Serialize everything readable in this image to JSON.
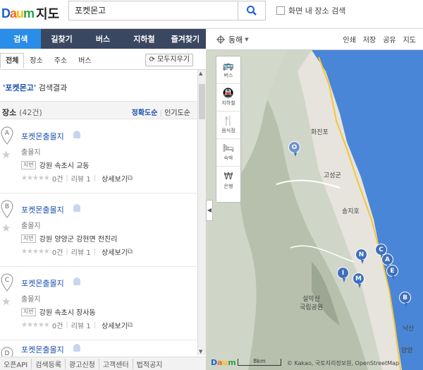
{
  "header": {
    "logo_text": "Daum",
    "map_title": "지도",
    "search_value": "포켓몬고",
    "in_map_label": "화면 내 장소 검색"
  },
  "nav": {
    "tabs": [
      "검색",
      "길찾기",
      "버스",
      "지하철",
      "즐겨찾기"
    ]
  },
  "subtabs": {
    "items": [
      "전체",
      "장소",
      "주소",
      "버스"
    ],
    "clear_label": "모두지우기"
  },
  "results": {
    "keyword": "'포켓몬고'",
    "suffix": " 검색결과",
    "section": "장소",
    "count": "(42건)",
    "sort_accuracy": "정확도순",
    "sort_popularity": "인기도순",
    "items": [
      {
        "letter": "A",
        "name": "포켓몬출몰지",
        "category": "출몰지",
        "jibun": "지번",
        "address": "강원 속초시 교동",
        "reviews_count": "0건",
        "reviews": "리뷰 1",
        "detail": "상세보기"
      },
      {
        "letter": "B",
        "name": "포켓몬출몰지",
        "category": "출몰지",
        "jibun": "지번",
        "address": "강원 양양군 강현면 전진리",
        "reviews_count": "0건",
        "reviews": "리뷰 1",
        "detail": "상세보기"
      },
      {
        "letter": "C",
        "name": "포켓몬출몰지",
        "category": "출몰지",
        "jibun": "지번",
        "address": "강원 속초시 장사동",
        "reviews_count": "0건",
        "reviews": "리뷰 1",
        "detail": "상세보기"
      },
      {
        "letter": "D",
        "name": "포켓몬출몰지"
      }
    ]
  },
  "footer": {
    "links": [
      "오픈API",
      "검색등록",
      "광고신청",
      "고객센터",
      "법적공지"
    ]
  },
  "map": {
    "region_label": "동해",
    "tools": [
      "인쇄",
      "저장",
      "공유",
      "지도"
    ],
    "side_tools": [
      {
        "icon": "bus-icon",
        "label": "버스"
      },
      {
        "icon": "subway-icon",
        "label": "지하철"
      },
      {
        "icon": "restaurant-icon",
        "label": "음식점"
      },
      {
        "icon": "lodging-icon",
        "label": "숙박"
      },
      {
        "icon": "bank-icon",
        "label": "은행"
      }
    ],
    "place_names": [
      "화진포",
      "고성군",
      "송지호",
      "설악산\n국립공원",
      "낙산",
      "양양"
    ],
    "markers": [
      "O",
      "N",
      "C",
      "A",
      "I",
      "M",
      "E",
      "B"
    ],
    "scale_label": "8km",
    "attribution": "© Kakao, 국토지리정보원, OpenStreetMap"
  }
}
